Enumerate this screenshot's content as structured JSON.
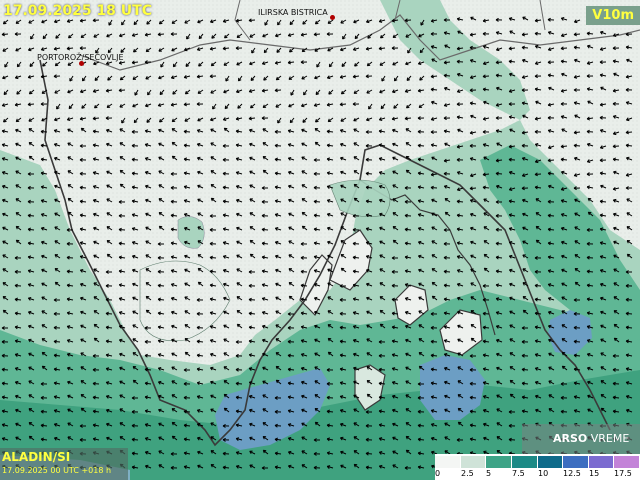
{
  "header": {
    "valid_time": "17.09.2025 18 UTC",
    "parameter": "V10m"
  },
  "places": [
    {
      "name": "ILIRSKA BISTRICA"
    },
    {
      "name": "PORTOROŽ/SEČOVLJE"
    }
  ],
  "footer": {
    "model": "ALADIN/SI",
    "run": "17.09.2025 00 UTC +018 h",
    "logo_bold": "ARSO",
    "logo_rest": "VREME"
  },
  "legend": {
    "labels": [
      "0",
      "2.5",
      "5",
      "7.5",
      "10",
      "12.5",
      "15",
      "17.5"
    ],
    "colors": [
      "#f4f6f4",
      "#cfe3d8",
      "#3ea487",
      "#1c8a86",
      "#0e6b8a",
      "#3d6ec0",
      "#7b6bd0",
      "#c383d8"
    ]
  },
  "map_colors": {
    "land": "#e9eeea",
    "sea_light": "#a9d4bf",
    "sea_mid": "#5fb795",
    "sea_strong": "#3fa27f",
    "sea_blue": "#6c9ec4",
    "coast": "#3a3a3a",
    "border": "#6a6a6a"
  },
  "icons": {
    "wind_arrow": "arrow-icon"
  }
}
